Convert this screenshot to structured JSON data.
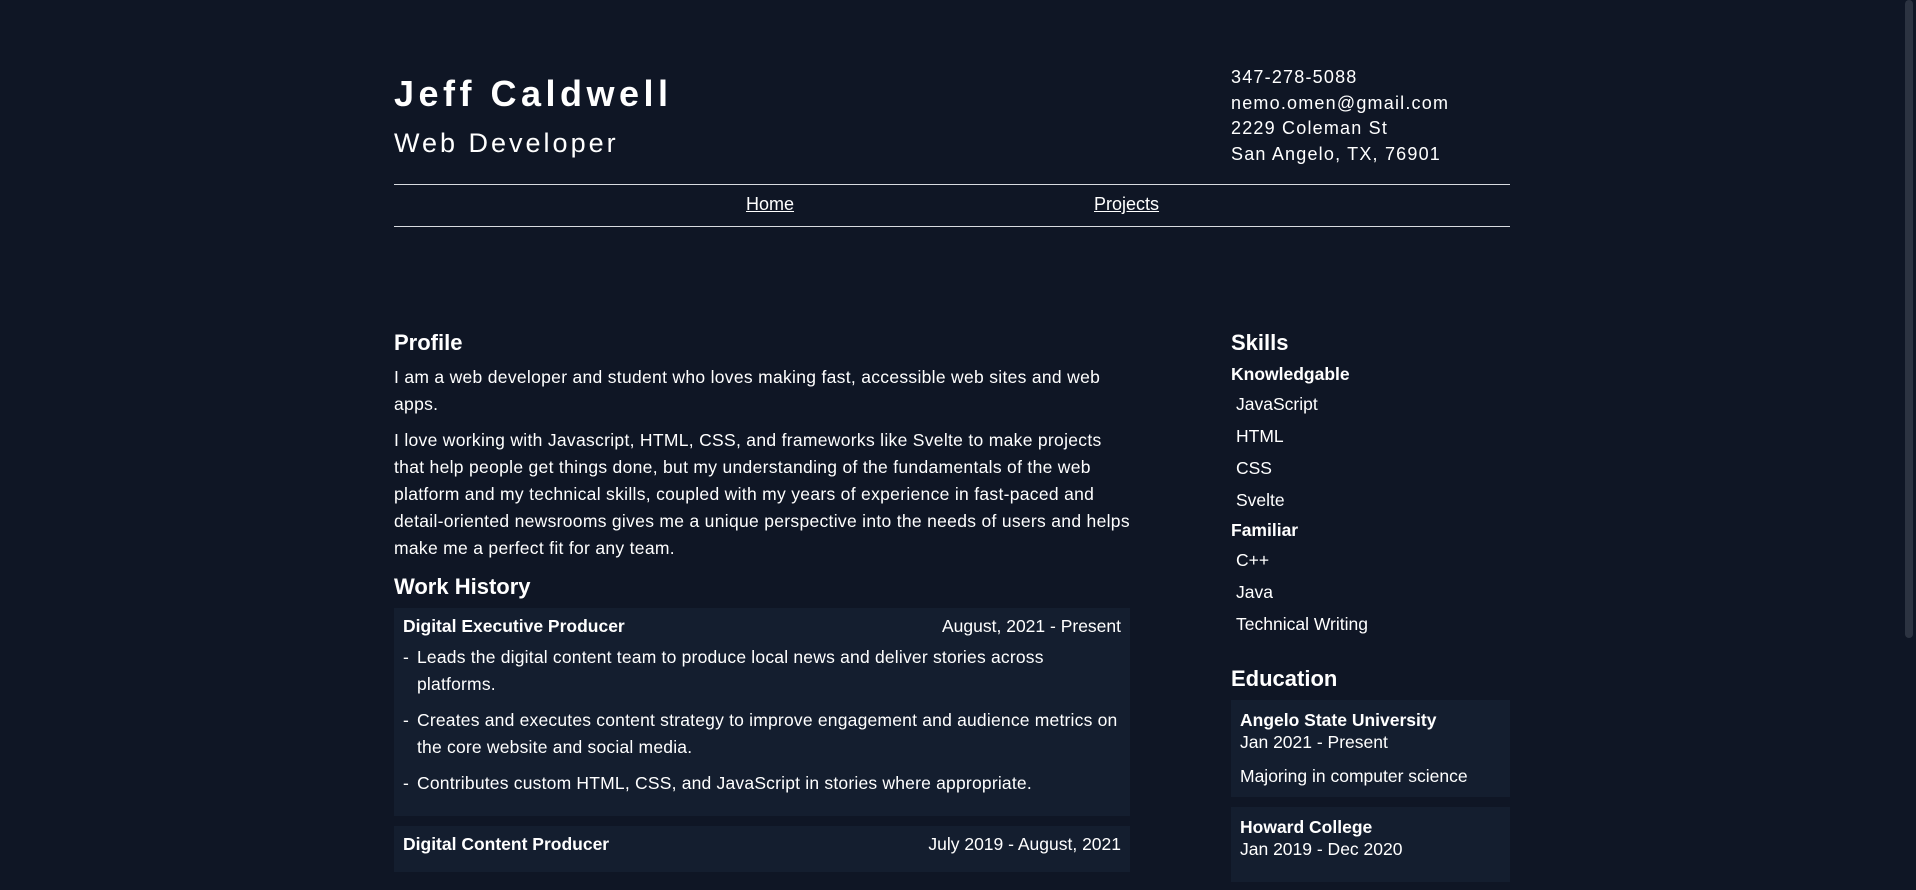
{
  "header": {
    "name": "Jeff Caldwell",
    "title": "Web Developer",
    "contact": {
      "phone": "347-278-5088",
      "email": "nemo.omen@gmail.com",
      "street": "2229 Coleman St",
      "city": "San Angelo, TX, 76901"
    }
  },
  "nav": {
    "home": "Home",
    "projects": "Projects"
  },
  "profile": {
    "heading": "Profile",
    "paragraphs": [
      "I am a web developer and student who loves making fast, accessible web sites and web apps.",
      "I love working with Javascript, HTML, CSS, and frameworks like Svelte to make projects that help people get things done, but my understanding of the fundamentals of the web platform and my technical skills, coupled with my years of experience in fast-paced and detail-oriented newsrooms gives me a unique perspective into the needs of users and helps make me a perfect fit for any team."
    ]
  },
  "work": {
    "heading": "Work History",
    "jobs": [
      {
        "role": "Digital Executive Producer",
        "dates": "August, 2021 - Present",
        "bullets": [
          "Leads the digital content team to produce local news and deliver stories across platforms.",
          "Creates and executes content strategy to improve engagement and audience metrics on the core website and social media.",
          "Contributes custom HTML, CSS, and JavaScript in stories where appropriate."
        ]
      },
      {
        "role": "Digital Content Producer",
        "dates": "July 2019 - August, 2021"
      }
    ]
  },
  "skills": {
    "heading": "Skills",
    "knowledgeable_label": "Knowledgable",
    "knowledgeable": [
      "JavaScript",
      "HTML",
      "CSS",
      "Svelte"
    ],
    "familiar_label": "Familiar",
    "familiar": [
      "C++",
      "Java",
      "Technical Writing"
    ]
  },
  "education": {
    "heading": "Education",
    "entries": [
      {
        "school": "Angelo State University",
        "dates": "Jan 2021 - Present",
        "note": "Majoring in computer science"
      },
      {
        "school": "Howard College",
        "dates": "Jan 2019 - Dec 2020"
      }
    ]
  },
  "colors": {
    "background": "#0f1625",
    "card": "#141e2f",
    "text": "#ffffff",
    "rule": "#d8dbe0"
  }
}
